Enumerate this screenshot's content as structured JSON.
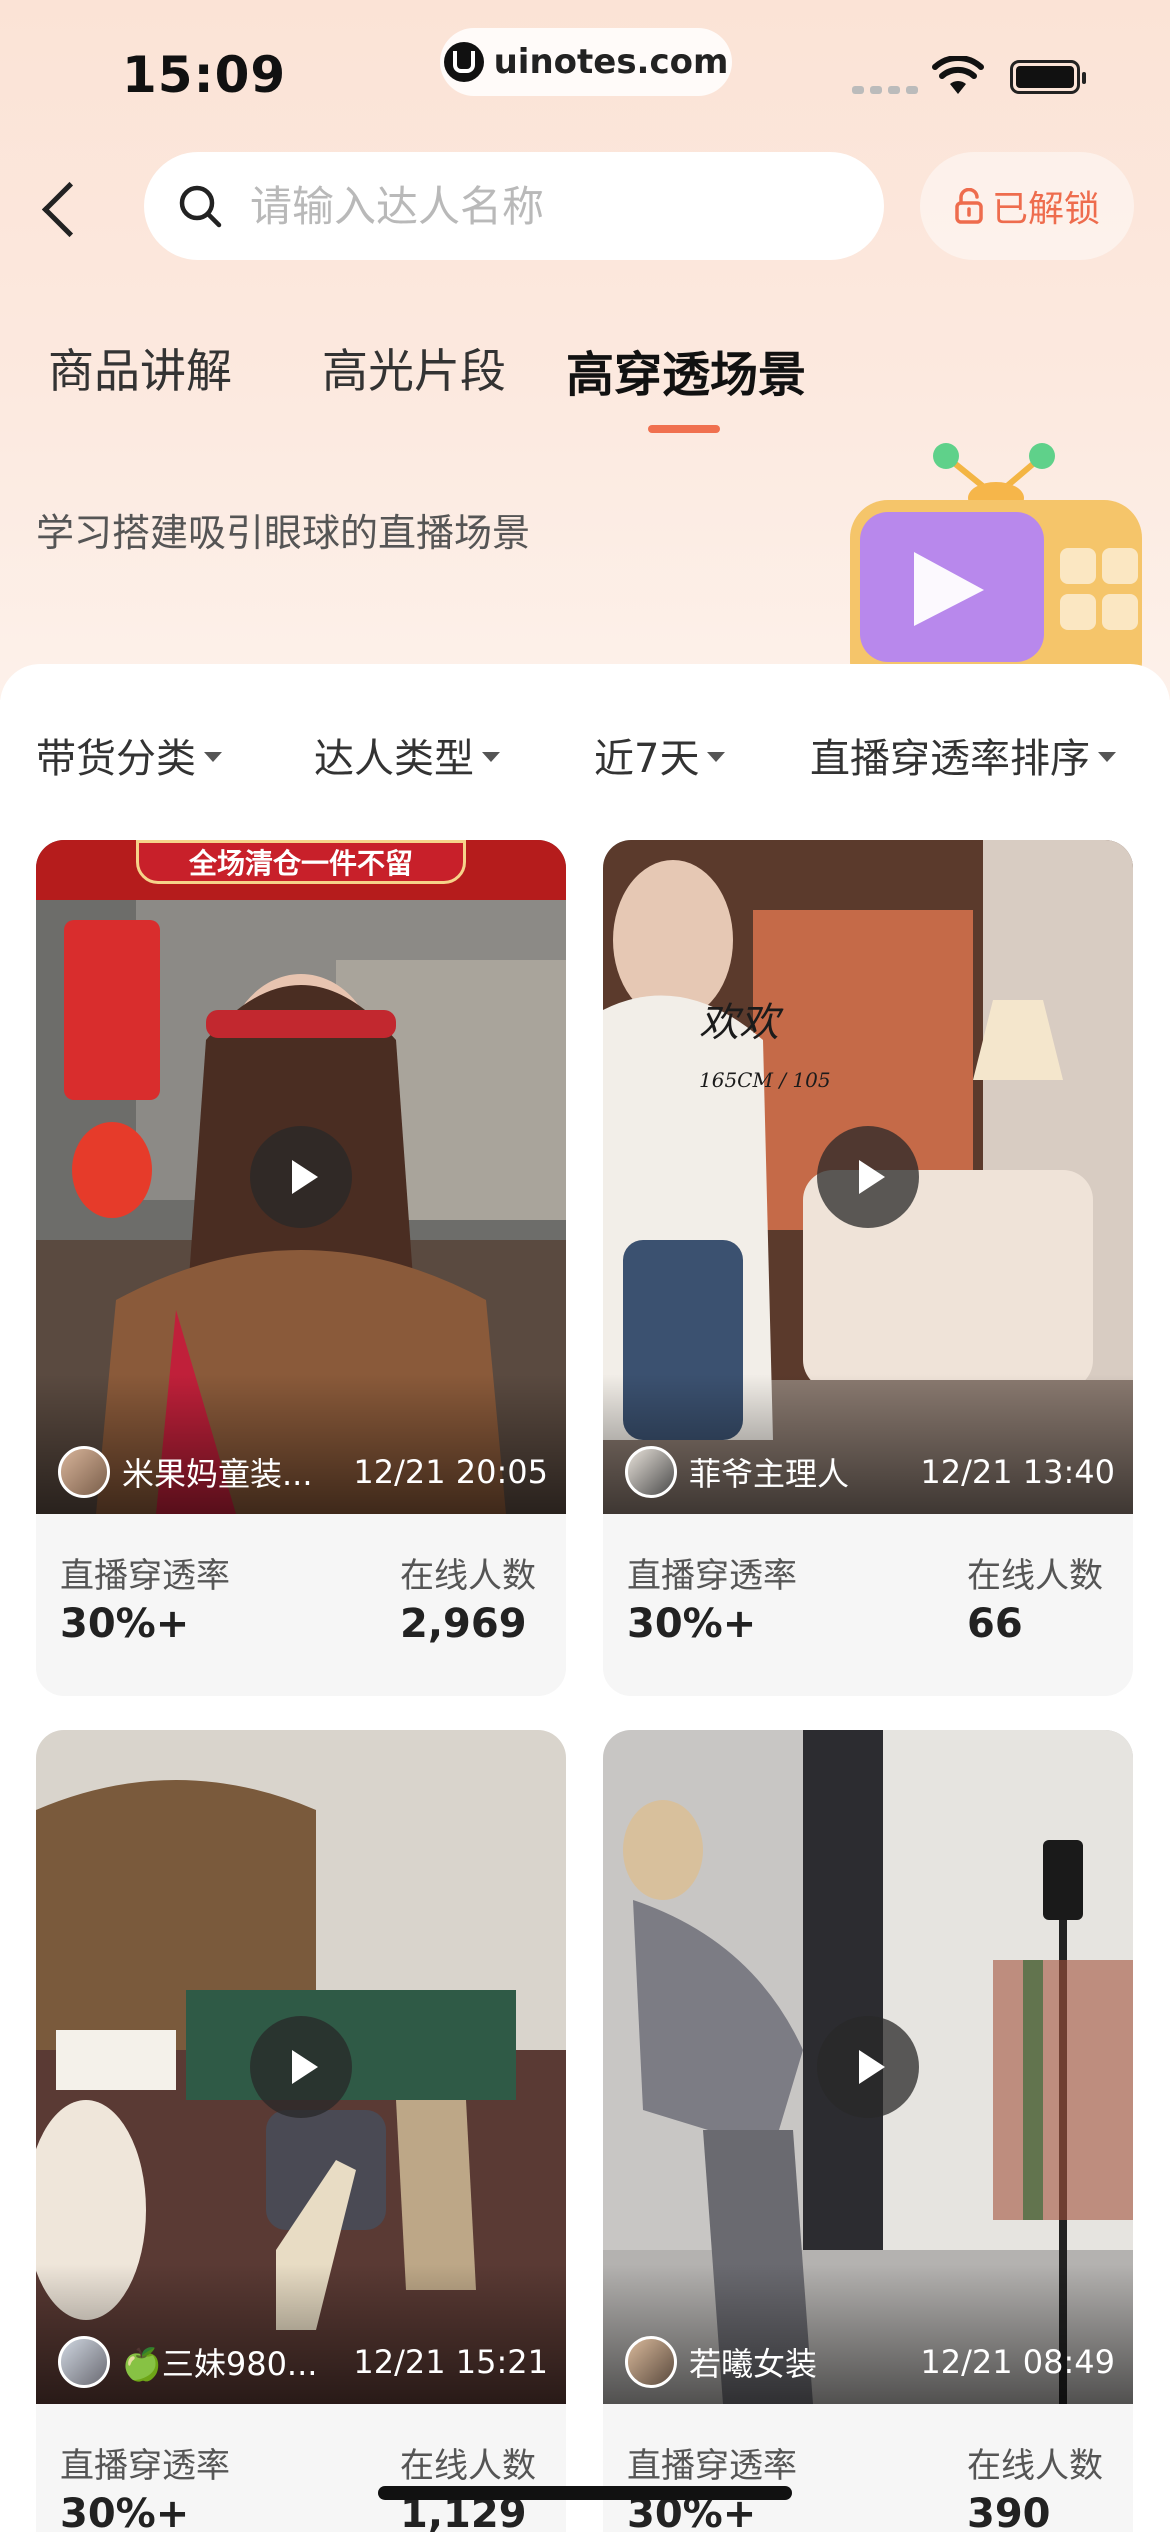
{
  "status_bar": {
    "time": "15:09",
    "url": "uinotes.com"
  },
  "header": {
    "search_placeholder": "请输入达人名称",
    "unlock_label": "已解锁"
  },
  "tabs": [
    {
      "label": "商品讲解",
      "active": false
    },
    {
      "label": "高光片段",
      "active": false
    },
    {
      "label": "高穿透场景",
      "active": true
    }
  ],
  "subtitle": "学习搭建吸引眼球的直播场景",
  "filters": [
    {
      "label": "带货分类"
    },
    {
      "label": "达人类型"
    },
    {
      "label": "近7天"
    },
    {
      "label": "直播穿透率排序"
    }
  ],
  "cards": [
    {
      "author": "米果妈童装...",
      "datetime": "12/21 20:05",
      "rate_label": "直播穿透率",
      "rate_value": "30%+",
      "online_label": "在线人数",
      "online_value": "2,969",
      "overlay_banner": "全场清仓一件不留"
    },
    {
      "author": "菲爷主理人",
      "datetime": "12/21 13:40",
      "rate_label": "直播穿透率",
      "rate_value": "30%+",
      "online_label": "在线人数",
      "online_value": "66",
      "overlay_text": "欢欢",
      "overlay_sub": "165CM / 105"
    },
    {
      "author": "🍏三妹980...",
      "datetime": "12/21 15:21",
      "rate_label": "直播穿透率",
      "rate_value": "30%+",
      "online_label": "在线人数",
      "online_value": "1,129"
    },
    {
      "author": "若曦女装",
      "datetime": "12/21 08:49",
      "rate_label": "直播穿透率",
      "rate_value": "30%+",
      "online_label": "在线人数",
      "online_value": "390"
    }
  ],
  "colors": {
    "accent": "#f0704f",
    "unlock": "#ee6c4d",
    "header_bg": "#fbe3d6"
  }
}
